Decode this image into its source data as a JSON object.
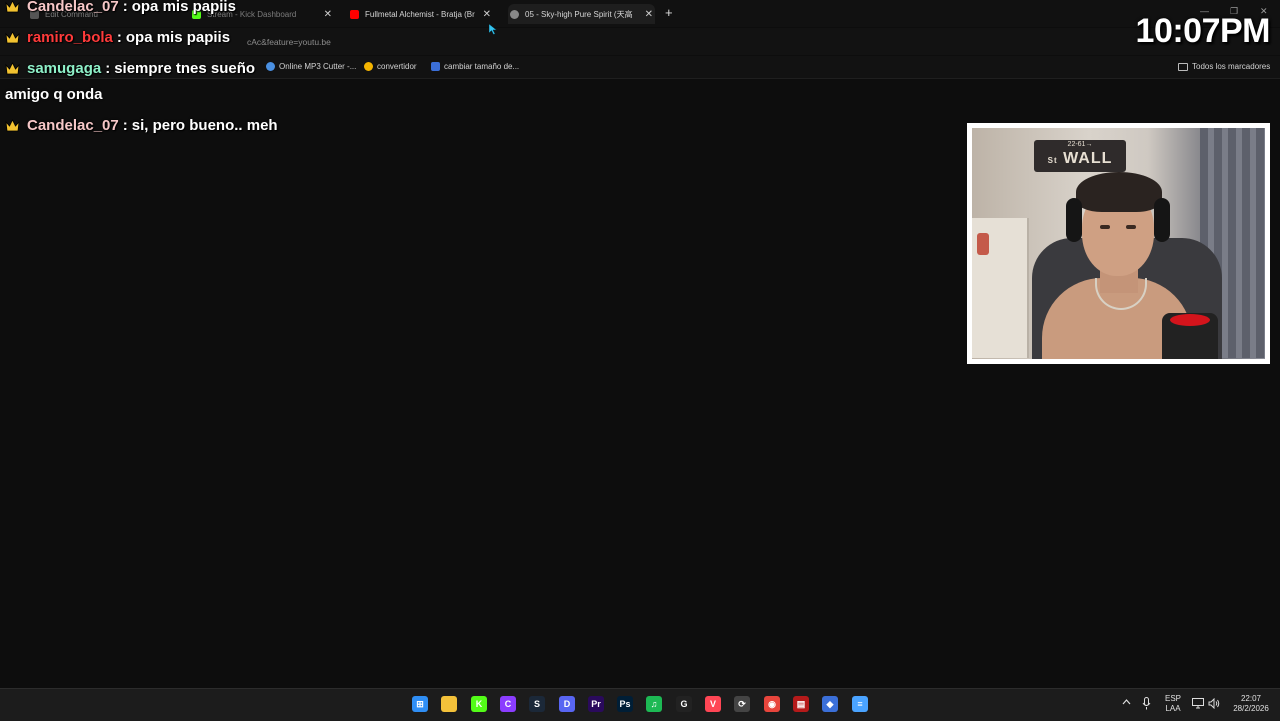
{
  "browser": {
    "tabs": [
      {
        "label": "Edit Command",
        "fav_color": "#555555",
        "dim": true
      },
      {
        "label": "Stream - Kick Dashboard",
        "fav_color": "#53fc18",
        "dim": true
      },
      {
        "label": "Fullmetal Alchemist - Bratja (Br",
        "fav_color": "#ff0000",
        "dim": false
      },
      {
        "label": "05 - Sky-high Pure Spirit (天高",
        "fav_color": "#888888",
        "dim": false
      }
    ],
    "new_tab": "+",
    "window_controls": [
      "—",
      "❐",
      "✕"
    ],
    "url_visible": "cAc&feature=youtu.be",
    "bookmarks": [
      {
        "label": "Online MP3 Cutter -...",
        "icon_color": "#4a90e2"
      },
      {
        "label": "convertidor",
        "icon_color": "#f4b400"
      },
      {
        "label": "cambiar tamaño de...",
        "icon_color": "#3b6fd8"
      }
    ],
    "all_bookmarks": "Todos los marcadores"
  },
  "chat": {
    "messages": [
      {
        "user": "Candelac_07",
        "user_color": "#f6c7c7",
        "text": "opa mis papiis"
      },
      {
        "user": "ramiro_bola",
        "user_color": "#ff3b3b",
        "text": "opa mis papiis"
      },
      {
        "user": "samugaga",
        "user_color": "#8ef0c8",
        "text": "siempre tnes sueño"
      },
      {
        "user": "Candelac_07",
        "user_color": "#f6c7c7",
        "text": "si, pero bueno.. meh"
      }
    ],
    "continuation": "amigo q onda",
    "separator": ":",
    "crown_icon": "crown-icon",
    "crown_color": "#f2c230"
  },
  "clock": "10:07PM",
  "webcam": {
    "sign_top": "22-61→",
    "sign_main": "WALL",
    "sign_st": "St"
  },
  "taskbar": {
    "icons": [
      {
        "name": "windows-start-icon",
        "color": "#2f8ef5",
        "glyph": "⊞"
      },
      {
        "name": "file-explorer-icon",
        "color": "#f3c13a",
        "glyph": ""
      },
      {
        "name": "kick-icon",
        "color": "#53fc18",
        "glyph": "K"
      },
      {
        "name": "canva-icon",
        "color": "#8b3dff",
        "glyph": "C"
      },
      {
        "name": "steam-icon",
        "color": "#1b2838",
        "glyph": "S"
      },
      {
        "name": "discord-icon",
        "color": "#5865f2",
        "glyph": "D"
      },
      {
        "name": "premiere-icon",
        "color": "#2a0a5c",
        "glyph": "Pr"
      },
      {
        "name": "photoshop-icon",
        "color": "#001e36",
        "glyph": "Ps"
      },
      {
        "name": "spotify-icon",
        "color": "#1db954",
        "glyph": "♫"
      },
      {
        "name": "logitech-icon",
        "color": "#222222",
        "glyph": "G"
      },
      {
        "name": "valorant-icon",
        "color": "#ff4655",
        "glyph": "V"
      },
      {
        "name": "riot-icon",
        "color": "#444444",
        "glyph": "⟳"
      },
      {
        "name": "chrome-icon",
        "color": "#e8453c",
        "glyph": "◉"
      },
      {
        "name": "obs-icon",
        "color": "#b51a1a",
        "glyph": "▤"
      },
      {
        "name": "vscode-icon",
        "color": "#3b6fd8",
        "glyph": "◆"
      },
      {
        "name": "notepad-icon",
        "color": "#4aa3ff",
        "glyph": "≡"
      }
    ],
    "lang_top": "ESP",
    "lang_bottom": "LAA",
    "time": "22:07",
    "date": "28/2/2026"
  }
}
